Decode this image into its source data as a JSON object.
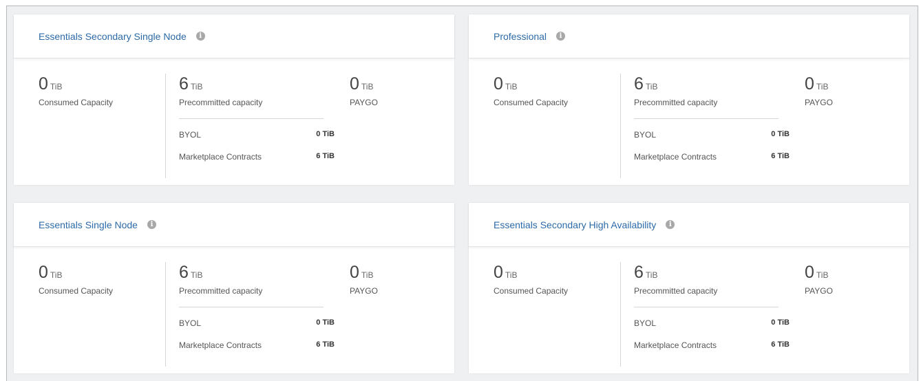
{
  "cards": [
    {
      "title": "Essentials Secondary Single Node",
      "consumed": {
        "value": "0",
        "unit": "TiB",
        "label": "Consumed Capacity"
      },
      "precommitted": {
        "value": "6",
        "unit": "TiB",
        "label": "Precommitted capacity"
      },
      "paygo": {
        "value": "0",
        "unit": "TiB",
        "label": "PAYGO"
      },
      "breakdown": [
        {
          "label": "BYOL",
          "value": "0 TiB"
        },
        {
          "label": "Marketplace Contracts",
          "value": "6 TiB"
        }
      ]
    },
    {
      "title": "Professional",
      "consumed": {
        "value": "0",
        "unit": "TiB",
        "label": "Consumed Capacity"
      },
      "precommitted": {
        "value": "6",
        "unit": "TiB",
        "label": "Precommitted capacity"
      },
      "paygo": {
        "value": "0",
        "unit": "TiB",
        "label": "PAYGO"
      },
      "breakdown": [
        {
          "label": "BYOL",
          "value": "0 TiB"
        },
        {
          "label": "Marketplace Contracts",
          "value": "6 TiB"
        }
      ]
    },
    {
      "title": "Essentials Single Node",
      "consumed": {
        "value": "0",
        "unit": "TiB",
        "label": "Consumed Capacity"
      },
      "precommitted": {
        "value": "6",
        "unit": "TiB",
        "label": "Precommitted capacity"
      },
      "paygo": {
        "value": "0",
        "unit": "TiB",
        "label": "PAYGO"
      },
      "breakdown": [
        {
          "label": "BYOL",
          "value": "0 TiB"
        },
        {
          "label": "Marketplace Contracts",
          "value": "6 TiB"
        }
      ]
    },
    {
      "title": "Essentials Secondary High Availability",
      "consumed": {
        "value": "0",
        "unit": "TiB",
        "label": "Consumed Capacity"
      },
      "precommitted": {
        "value": "6",
        "unit": "TiB",
        "label": "Precommitted capacity"
      },
      "paygo": {
        "value": "0",
        "unit": "TiB",
        "label": "PAYGO"
      },
      "breakdown": [
        {
          "label": "BYOL",
          "value": "0 TiB"
        },
        {
          "label": "Marketplace Contracts",
          "value": "6 TiB"
        }
      ]
    }
  ],
  "icons": {
    "info": "info-icon"
  },
  "colors": {
    "title": "#2c6aa8",
    "background": "#eff0f2",
    "card": "#ffffff"
  }
}
